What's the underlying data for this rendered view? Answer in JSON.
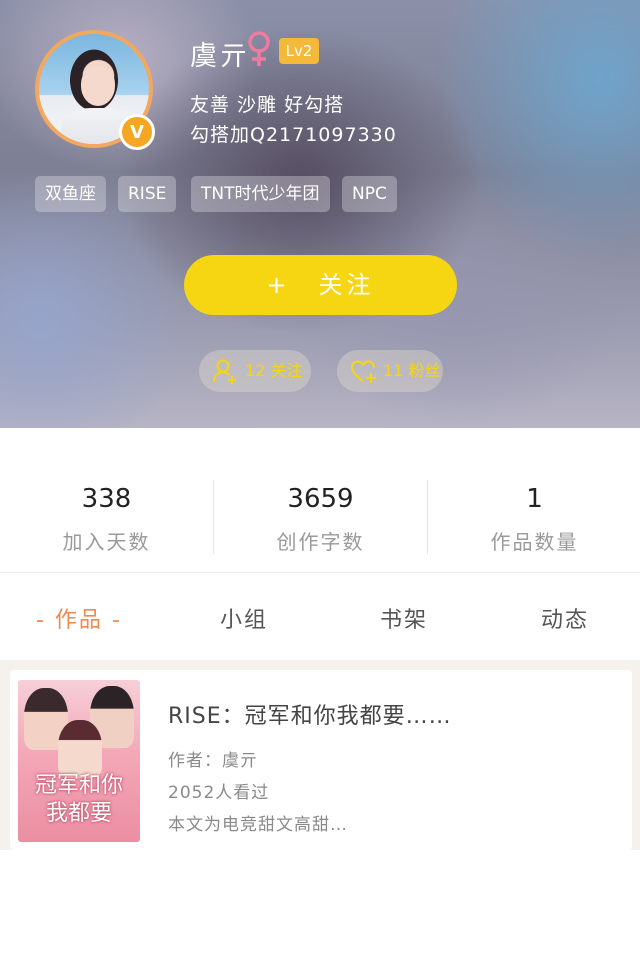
{
  "profile": {
    "username": "虞亓",
    "gender": "female",
    "level": "Lv2",
    "bio": [
      "友善 沙雕 好勾搭",
      "勾搭加Q2171097330"
    ],
    "verified_badge": "V",
    "tags": [
      "双鱼座",
      "RISE",
      "TNT时代少年团",
      "NPC"
    ],
    "follow_button": "+　关注",
    "following_pill": "12 关注",
    "followers_pill": "11 粉丝"
  },
  "stats": [
    {
      "value": "338",
      "label": "加入天数"
    },
    {
      "value": "3659",
      "label": "创作字数"
    },
    {
      "value": "1",
      "label": "作品数量"
    }
  ],
  "tabs": [
    {
      "label": "- 作品 -",
      "active": true
    },
    {
      "label": "小组",
      "active": false
    },
    {
      "label": "书架",
      "active": false
    },
    {
      "label": "动态",
      "active": false
    }
  ],
  "works": [
    {
      "title": "RISE：冠军和你我都要……",
      "author": "作者：虞亓",
      "views": "2052人看过",
      "summary": "本文为电竞甜文高甜…",
      "cover_text": [
        "冠军和你",
        "我都要"
      ]
    }
  ],
  "colors": {
    "accent_yellow": "#f6d513",
    "accent_orange": "#f18a4e",
    "level_badge": "#f5b93a",
    "gender_pink": "#f07aa0"
  },
  "icons": [
    "verified-icon",
    "female-icon",
    "add-user-icon",
    "heart-add-icon"
  ]
}
